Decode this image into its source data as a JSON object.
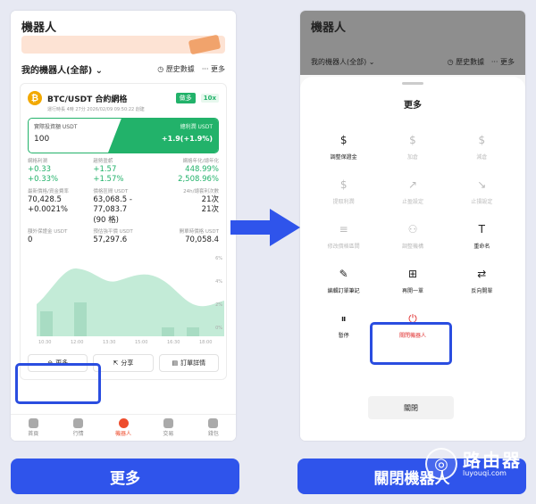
{
  "left": {
    "app_title": "機器人",
    "robots_label": "我的機器人(全部)",
    "history_label": "歷史數據",
    "more_label": "更多",
    "pair_title": "BTC/USDT 合約網格",
    "run_info": "運行時長 4時 27分 2026/02/09 09:50:22 創建",
    "side_badge": "做多",
    "leverage_badge": "10x",
    "invest_label": "實際投資額 USDT",
    "invest_value": "100",
    "profit_label": "總利潤 USDT",
    "profit_value": "+1.9(+1.9%)",
    "stats": [
      {
        "label": "網格利潤",
        "v1": "+0.33",
        "v2": "+0.33%"
      },
      {
        "label": "趨勢盈虧",
        "v1": "+1.57",
        "v2": "+1.57%"
      },
      {
        "label": "網格年化/總年化",
        "v1": "448.99%",
        "v2": "2,508.96%"
      },
      {
        "label": "最新價格/資金費率",
        "v1": "70,428.5",
        "v2": "+0.0021%"
      },
      {
        "label": "價格區間 USDT",
        "v1": "63,068.5 - 77,083.7",
        "v2": "(90 格)"
      },
      {
        "label": "24h/總套利次數",
        "v1": "21次",
        "v2": "21次"
      },
      {
        "label": "額外保證金 USDT",
        "v1": "0",
        "v2": ""
      },
      {
        "label": "預估強平價 USDT",
        "v1": "57,297.6",
        "v2": ""
      },
      {
        "label": "開單時價格 USDT",
        "v1": "70,058.4",
        "v2": ""
      }
    ],
    "chart_y_ticks": [
      "6%",
      "4%",
      "2%",
      "0%"
    ],
    "chart_x_ticks": [
      "10:30",
      "12:00",
      "13:30",
      "15:00",
      "16:30",
      "18:00"
    ],
    "buttons": {
      "more": "更多",
      "share": "分享",
      "order_detail": "訂單詳情"
    },
    "tabs": [
      "首頁",
      "行情",
      "機器人",
      "交易",
      "錢包"
    ]
  },
  "right": {
    "app_title": "機器人",
    "robots_label": "我的機器人(全部)",
    "history_label": "歷史數據",
    "more_label": "更多",
    "sheet_title": "更多",
    "items": [
      {
        "label": "調整保證金",
        "sub": "",
        "icon": "shield-dollar-icon",
        "glyph": "$",
        "state": "normal"
      },
      {
        "label": "加倉",
        "sub": "",
        "icon": "coin-plus-icon",
        "glyph": "$",
        "state": "disabled"
      },
      {
        "label": "減倉",
        "sub": "",
        "icon": "coin-minus-icon",
        "glyph": "$",
        "state": "disabled"
      },
      {
        "label": "提取利潤",
        "sub": "",
        "icon": "withdraw-icon",
        "glyph": "$",
        "state": "disabled"
      },
      {
        "label": "止盈設定",
        "sub": "",
        "icon": "take-profit-icon",
        "glyph": "↗",
        "state": "disabled"
      },
      {
        "label": "止損設定",
        "sub": "",
        "icon": "stop-loss-icon",
        "glyph": "↘",
        "state": "disabled"
      },
      {
        "label": "修改價格區間",
        "sub": "",
        "icon": "sliders-icon",
        "glyph": "≡",
        "state": "disabled"
      },
      {
        "label": "調整機構",
        "sub": "",
        "icon": "users-icon",
        "glyph": "⚇",
        "state": "disabled"
      },
      {
        "label": "重命名",
        "sub": "",
        "icon": "rename-icon",
        "glyph": "T",
        "state": "normal"
      },
      {
        "label": "編輯訂單筆記",
        "sub": "",
        "icon": "pen-icon",
        "glyph": "✎",
        "state": "normal"
      },
      {
        "label": "再開一單",
        "sub": "",
        "icon": "reopen-icon",
        "glyph": "⊞",
        "state": "normal"
      },
      {
        "label": "反向開單",
        "sub": "",
        "icon": "reverse-icon",
        "glyph": "⇄",
        "state": "normal"
      },
      {
        "label": "暫停",
        "sub": "",
        "icon": "pause-icon",
        "glyph": "⏸",
        "state": "normal"
      },
      {
        "label": "關閉機器人",
        "sub": "",
        "icon": "power-icon",
        "glyph": "⏻",
        "state": "red"
      }
    ],
    "close_label": "關閉"
  },
  "captions": {
    "left": "更多",
    "right": "關閉機器人"
  },
  "watermark": {
    "big": "路由器",
    "small": "luyouqi.com"
  },
  "colors": {
    "accent_green": "#22b26a",
    "accent_blue": "#2f54eb",
    "highlight_blue": "#2a4de0",
    "danger_red": "#e03131",
    "tab_active": "#ee4d2d"
  }
}
